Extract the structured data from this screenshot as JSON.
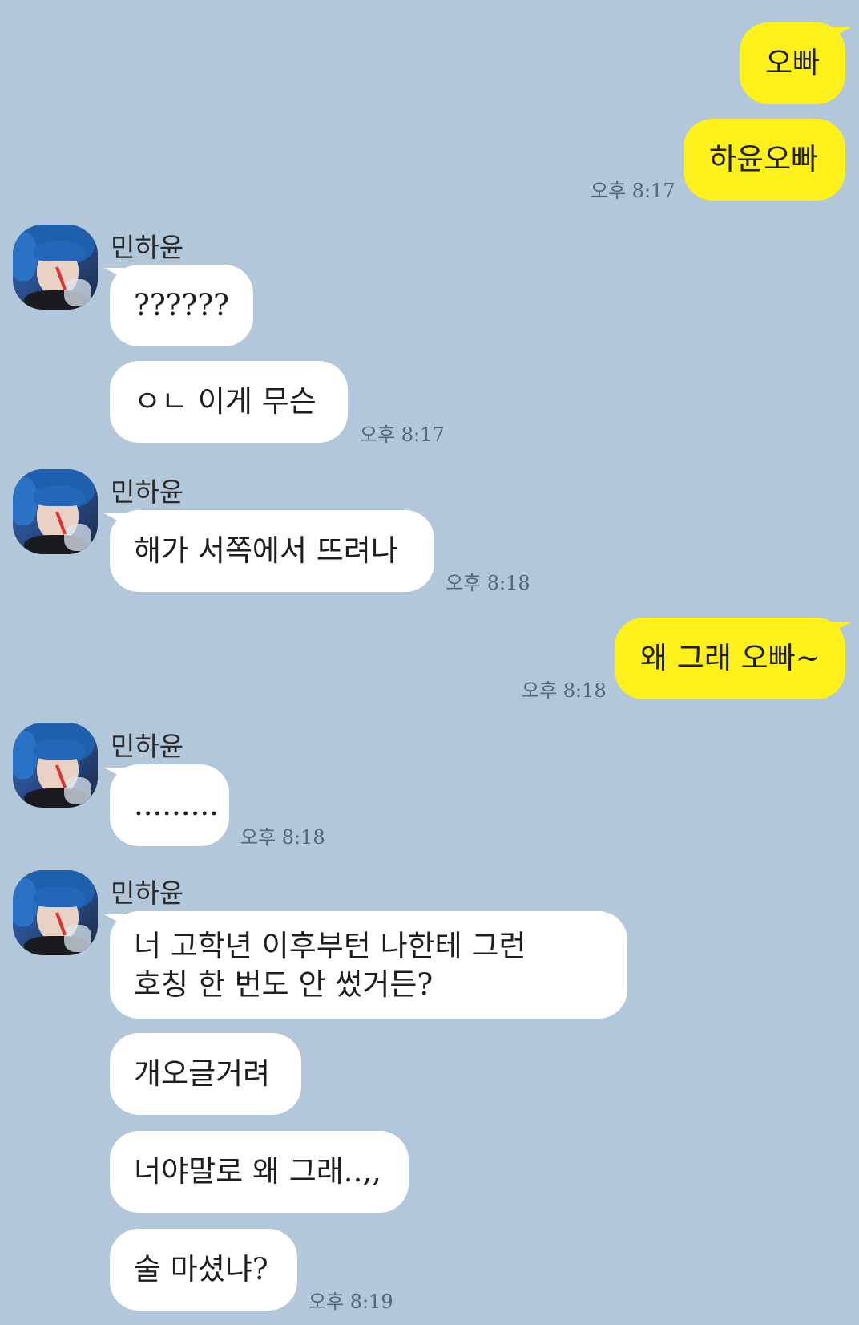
{
  "colors": {
    "background": "#b2c7da",
    "my_bubble": "#fef01b",
    "their_bubble": "#ffffff",
    "time_text": "#556677"
  },
  "messages": {
    "m1": {
      "text": "오빠"
    },
    "m2": {
      "text": "하윤오빠",
      "time": "오후 8:17"
    },
    "g1": {
      "sender": "민하윤",
      "msg1": "??????",
      "msg2": "ㅇㄴ 이게 무슨",
      "time": "오후 8:17"
    },
    "g2": {
      "sender": "민하윤",
      "msg1": "해가 서쪽에서 뜨려나",
      "time": "오후 8:18"
    },
    "m3": {
      "text": "왜 그래 오빠~",
      "time": "오후 8:18"
    },
    "g3": {
      "sender": "민하윤",
      "msg1": ".........",
      "time": "오후 8:18"
    },
    "g4": {
      "sender": "민하윤",
      "msg1_line1": "너 고학년 이후부턴 나한테 그런",
      "msg1_line2": "호칭 한 번도 안 썼거든?",
      "msg2": "개오글거려",
      "msg3": "너야말로 왜 그래..,,",
      "msg4": "술 마셨냐?",
      "time": "오후 8:19"
    }
  },
  "icons": {
    "avatar": "profile-photo-blue-hair"
  }
}
